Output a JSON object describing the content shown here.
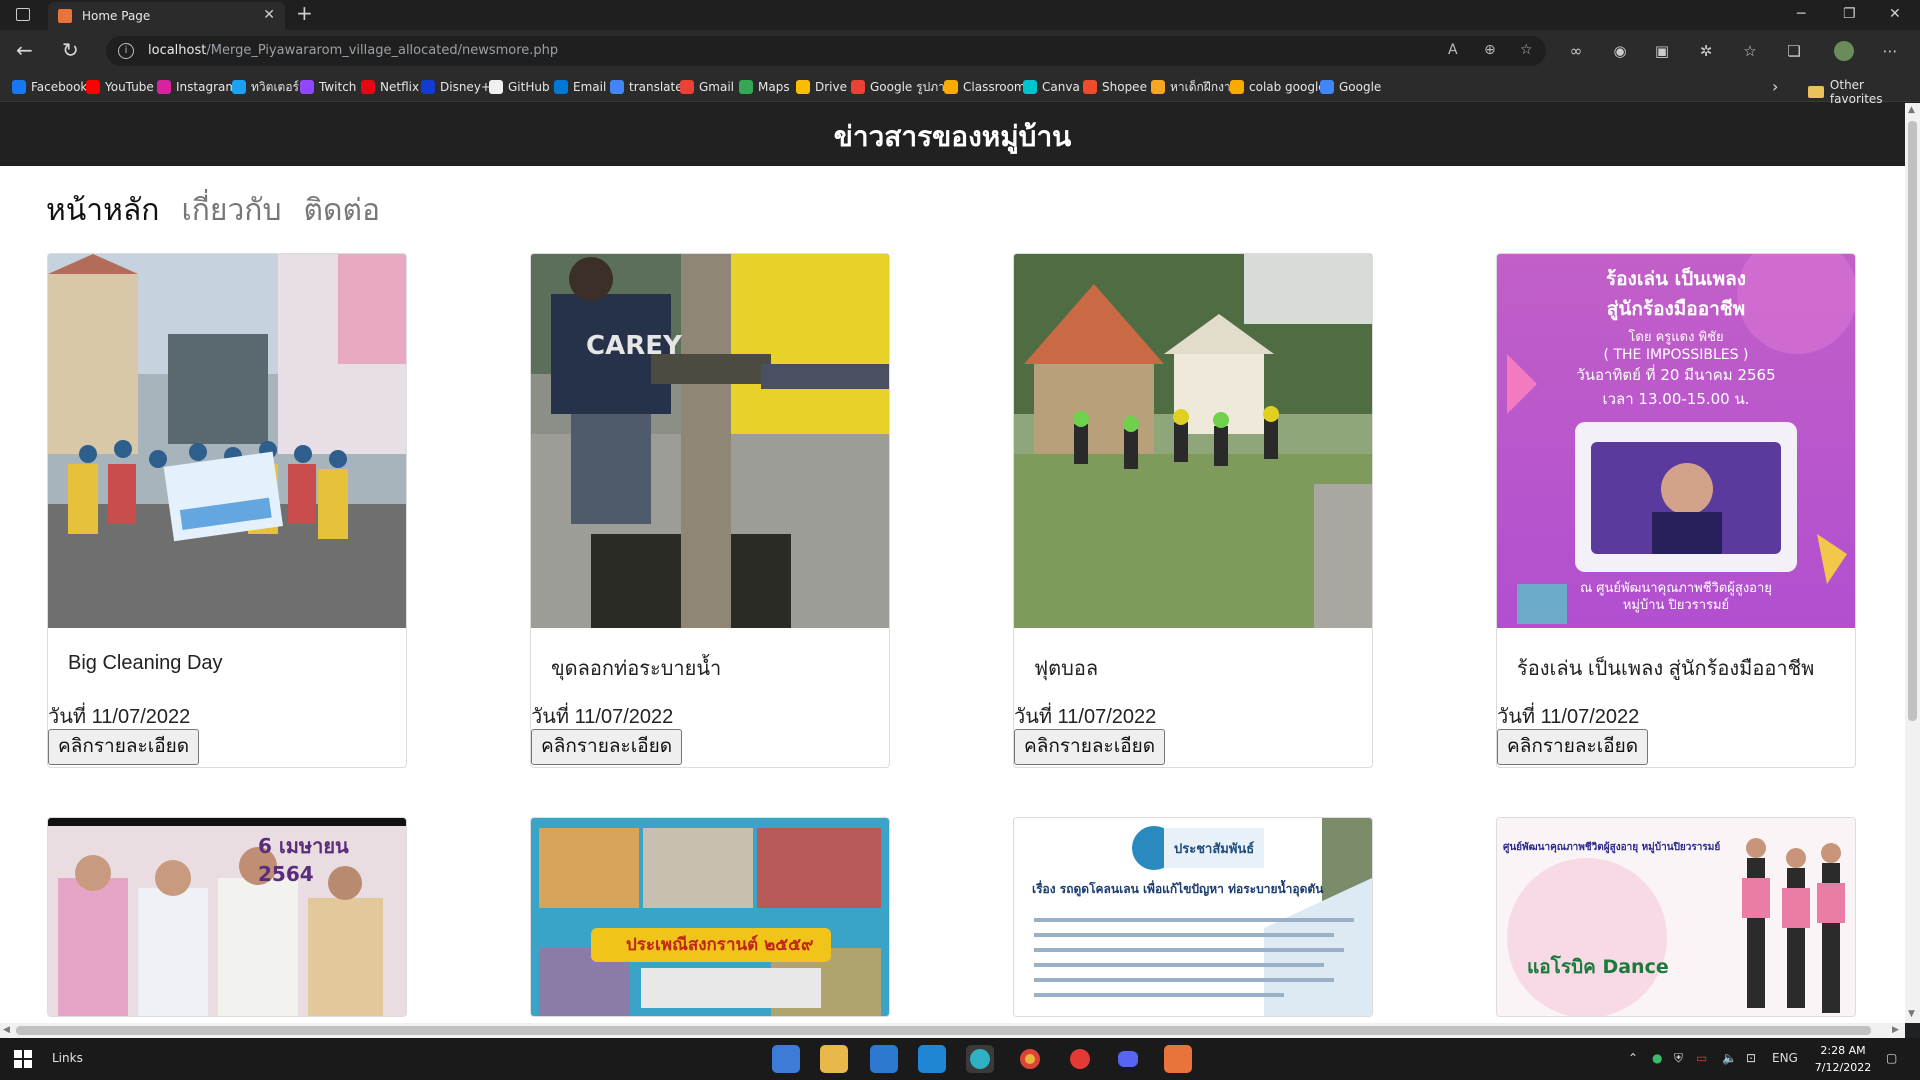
{
  "browser": {
    "tab_title": "Home Page",
    "url_host": "localhost",
    "url_path": "/Merge_Piyawararom_village_allocated/newsmore.php",
    "bookmarks": [
      {
        "label": "Facebook",
        "color": "#1877f2"
      },
      {
        "label": "YouTube",
        "color": "#ff0000"
      },
      {
        "label": "Instagram",
        "color": "#d6249f"
      },
      {
        "label": "ทวิตเตอร์",
        "color": "#1da1f2"
      },
      {
        "label": "Twitch",
        "color": "#9146ff"
      },
      {
        "label": "Netflix",
        "color": "#e50914"
      },
      {
        "label": "Disney+",
        "color": "#113ccf"
      },
      {
        "label": "GitHub",
        "color": "#f0f0f0"
      },
      {
        "label": "Email",
        "color": "#0078d4"
      },
      {
        "label": "translate",
        "color": "#4285f4"
      },
      {
        "label": "Gmail",
        "color": "#ea4335"
      },
      {
        "label": "Maps",
        "color": "#34a853"
      },
      {
        "label": "Drive",
        "color": "#fbbc04"
      },
      {
        "label": "Google รูปภาพ",
        "color": "#ea4335"
      },
      {
        "label": "Classroom",
        "color": "#f9ab00"
      },
      {
        "label": "Canva",
        "color": "#00c4cc"
      },
      {
        "label": "Shopee",
        "color": "#ee4d2d"
      },
      {
        "label": "หาเด็กฝึกงาน",
        "color": "#f5a623"
      },
      {
        "label": "colab google",
        "color": "#f9ab00"
      },
      {
        "label": "Google",
        "color": "#4285f4"
      }
    ],
    "other_favorites": "Other favorites"
  },
  "site": {
    "title": "ข่าวสารของหมู่บ้าน",
    "menu": [
      "หน้าหลัก",
      "เกี่ยวกับ",
      "ติดต่อ"
    ]
  },
  "news": [
    {
      "title": "Big Cleaning Day",
      "date": "วันที่ 11/07/2022",
      "button": "คลิกรายละเอียด"
    },
    {
      "title": "ขุดลอกท่อระบายน้ำ",
      "date": "วันที่ 11/07/2022",
      "button": "คลิกรายละเอียด"
    },
    {
      "title": "ฟุตบอล",
      "date": "วันที่ 11/07/2022",
      "button": "คลิกรายละเอียด"
    },
    {
      "title": "ร้องเล่น เป็นเพลง สู่นักร้องมืออาชีพ",
      "date": "วันที่ 11/07/2022",
      "button": "คลิกรายละเอียด"
    }
  ],
  "poster": {
    "line1": "ร้องเล่น เป็นเพลง",
    "line2": "สู่นักร้องมืออาชีพ",
    "line3": "โดย ครูแดง พิชัย",
    "line4": "( THE IMPOSSIBLES )",
    "line5": "วันอาทิตย์ ที่ 20 มีนาคม 2565",
    "line6": "เวลา 13.00-15.00 น.",
    "line7": "ณ ศูนย์พัฒนาคุณภาพชีวิตผู้สูงอายุ",
    "line8": "หมู่บ้าน ปิยวรารมย์"
  },
  "row2_text": {
    "date_banner": "6 เมษายน 2564",
    "songkran": "ประเพณีสงกรานต์ ๒๕๕๙",
    "pr": "ประชาสัมพันธ์",
    "pr_subject": "เรื่อง  รถดูดโคลนเลน  เพื่อแก้ไขปัญหา ท่อระบายน้ำอุดตัน",
    "aerobic_header": "ศูนย์พัฒนาคุณภาพชีวิตผู้สูงอายุ หมู่บ้านปิยวรารมย์",
    "aerobic_title": "แอโรบิค Dance"
  },
  "taskbar": {
    "links": "Links",
    "lang": "ENG",
    "time": "2:28 AM",
    "date": "7/12/2022"
  }
}
